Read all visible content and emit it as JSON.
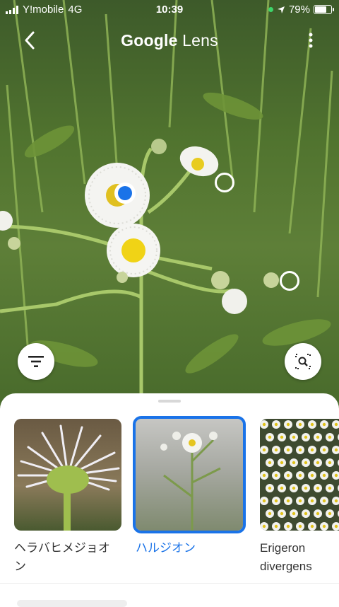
{
  "status_bar": {
    "carrier": "Y!mobile",
    "network": "4G",
    "time": "10:39",
    "battery_percent": "79%",
    "battery_level": 0.79
  },
  "header": {
    "title_brand": "Google",
    "title_product": "Lens",
    "back_icon": "chevron-left-icon",
    "more_icon": "more-vert-icon"
  },
  "photo": {
    "selected_color": "#1a73e8"
  },
  "results": [
    {
      "label": "ヘラバヒメジョオン",
      "selected": false
    },
    {
      "label": "ハルジオン",
      "selected": true
    },
    {
      "label": "Erigeron divergens",
      "selected": false
    }
  ],
  "accent": "#1a73e8"
}
